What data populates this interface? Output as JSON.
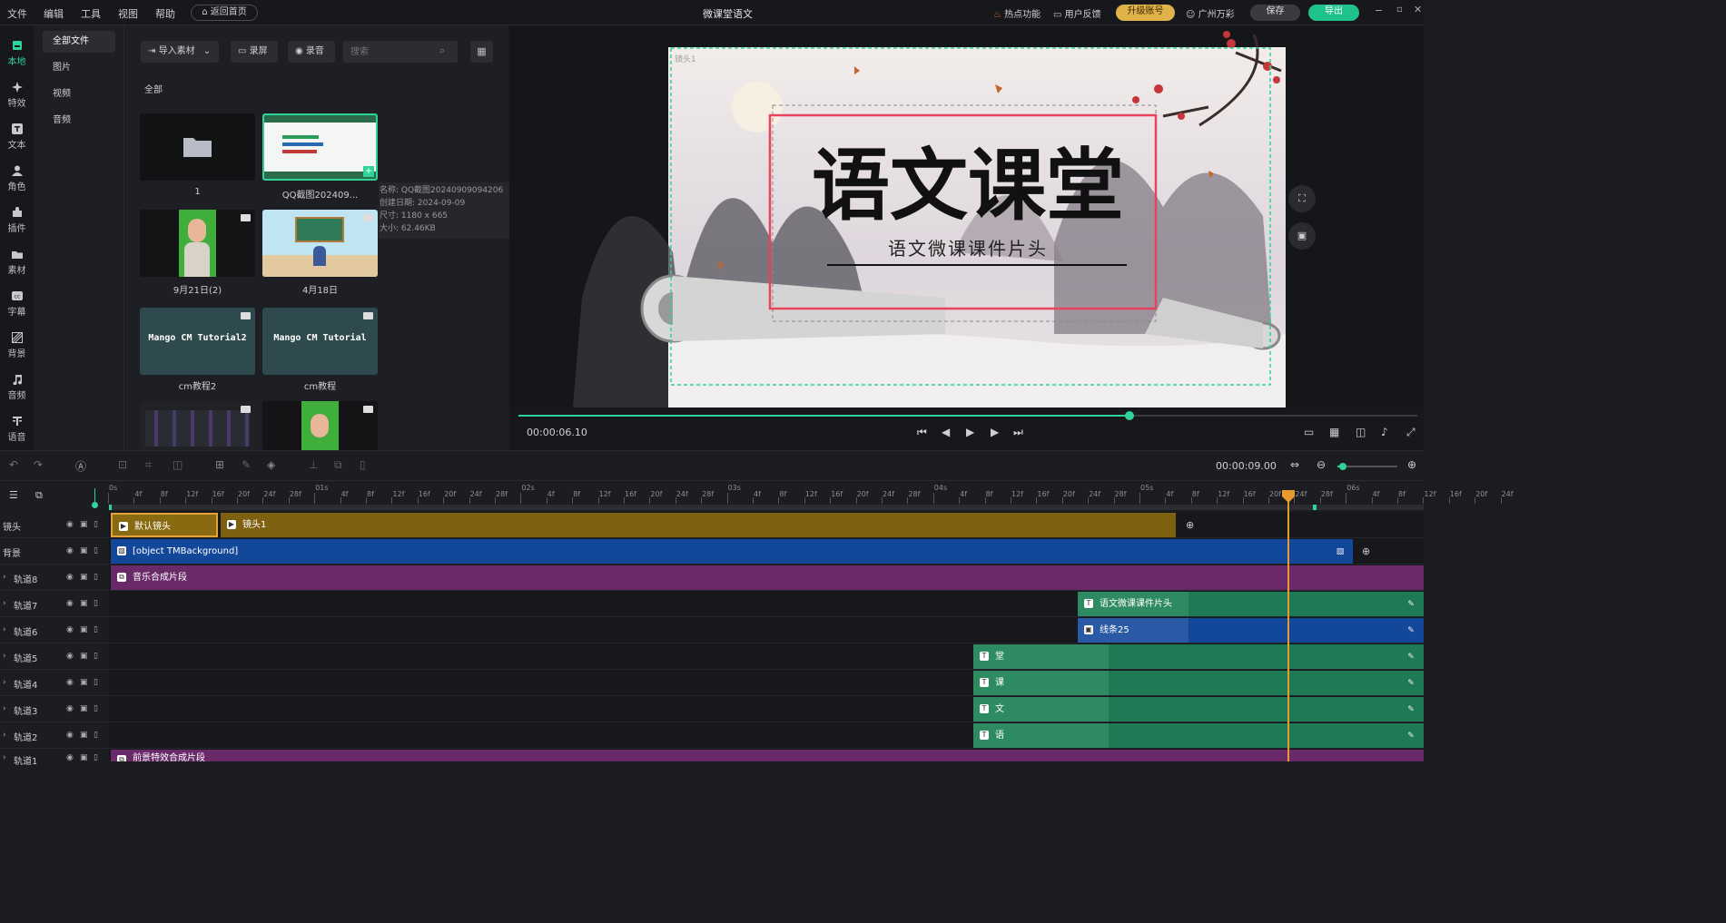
{
  "menu": {
    "file": "文件",
    "edit": "编辑",
    "tools": "工具",
    "view": "视图",
    "help": "帮助",
    "home": "返回首页"
  },
  "title": "微课堂语文",
  "header": {
    "hot": "热点功能",
    "feedback": "用户反馈",
    "upgrade": "升级账号",
    "user": "广州万彩",
    "save": "保存",
    "export": "导出"
  },
  "sidebar": [
    {
      "label": "本地",
      "icon": "local-icon"
    },
    {
      "label": "特效",
      "icon": "effects-icon"
    },
    {
      "label": "文本",
      "icon": "text-icon"
    },
    {
      "label": "角色",
      "icon": "character-icon"
    },
    {
      "label": "插件",
      "icon": "plugin-icon"
    },
    {
      "label": "素材",
      "icon": "material-icon"
    },
    {
      "label": "字幕",
      "icon": "subtitle-icon"
    },
    {
      "label": "背景",
      "icon": "background-icon"
    },
    {
      "label": "音频",
      "icon": "audio-icon"
    },
    {
      "label": "语音",
      "icon": "voice-icon"
    }
  ],
  "subnav": [
    "全部文件",
    "图片",
    "视频",
    "音频"
  ],
  "media": {
    "import": "导入素材",
    "record_screen": "录屏",
    "record_audio": "录音",
    "search_placeholder": "搜索",
    "section": "全部",
    "items": [
      {
        "name": "1"
      },
      {
        "name": "QQ截图202409..."
      },
      {
        "name": "9月21日(2)"
      },
      {
        "name": "4月18日"
      },
      {
        "name": "cm教程2",
        "art": "Mango CM Tutorial2"
      },
      {
        "name": "cm教程",
        "art": "Mango CM Tutorial"
      },
      {
        "name": ""
      },
      {
        "name": ""
      }
    ]
  },
  "tooltip": {
    "name": "名称: QQ截图20240909094206",
    "date": "创建日期: 2024-09-09",
    "size": "尺寸: 1180 x 665",
    "filesize": "大小: 62.46KB"
  },
  "preview": {
    "lens_label": "镜头1",
    "title_text": "语文课堂",
    "subtitle_text": "语文微课课件片头"
  },
  "player": {
    "current_time": "00:00:06.10",
    "progress": 0.68
  },
  "timeline": {
    "total_time": "00:00:09.00",
    "ticks": [
      "0s",
      "4f",
      "8f",
      "12f",
      "16f",
      "20f",
      "24f",
      "28f",
      "01s",
      "4f",
      "8f",
      "12f",
      "16f",
      "20f",
      "24f",
      "28f",
      "02s",
      "4f",
      "8f",
      "12f",
      "16f",
      "20f",
      "24f",
      "28f",
      "03s",
      "4f",
      "8f",
      "12f",
      "16f",
      "20f",
      "24f",
      "28f",
      "04s",
      "4f",
      "8f",
      "12f",
      "16f",
      "20f",
      "24f",
      "28f",
      "05s",
      "4f",
      "8f",
      "12f",
      "16f",
      "20f",
      "24f",
      "28f",
      "06s",
      "4f",
      "8f",
      "12f",
      "16f",
      "20f",
      "24f"
    ],
    "tracks": [
      {
        "name": "镜头",
        "clips": [
          {
            "label": "默认镜头"
          },
          {
            "label": "镜头1"
          }
        ]
      },
      {
        "name": "背景",
        "clips": [
          {
            "label": "[object TMBackground]"
          }
        ]
      },
      {
        "name": "轨道8",
        "clips": [
          {
            "label": "音乐合成片段"
          }
        ]
      },
      {
        "name": "轨道7",
        "clips": [
          {
            "label": "语文微课课件片头"
          }
        ]
      },
      {
        "name": "轨道6",
        "clips": [
          {
            "label": "线条25"
          }
        ]
      },
      {
        "name": "轨道5",
        "clips": [
          {
            "label": "堂"
          }
        ]
      },
      {
        "name": "轨道4",
        "clips": [
          {
            "label": "课"
          }
        ]
      },
      {
        "name": "轨道3",
        "clips": [
          {
            "label": "文"
          }
        ]
      },
      {
        "name": "轨道2",
        "clips": [
          {
            "label": "语"
          }
        ]
      },
      {
        "name": "轨道1",
        "clips": [
          {
            "label": "前景特效合成片段"
          }
        ]
      }
    ]
  },
  "colors": {
    "accent": "#2fd39a",
    "upgrade": "#e0b24a",
    "camera": "#7d6110",
    "background": "#12479a",
    "music": "#6a2a6a",
    "text": "#1d7a55",
    "playhead": "#e89a2c"
  }
}
